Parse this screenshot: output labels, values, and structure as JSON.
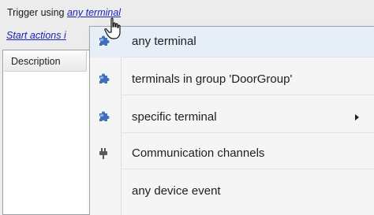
{
  "trigger": {
    "prefix": "Trigger using",
    "link": "any terminal"
  },
  "start_actions": {
    "label": "Start actions i"
  },
  "table": {
    "column_description": "Description"
  },
  "menu": {
    "items": [
      {
        "label": "any terminal",
        "icon": "puzzle-icon"
      },
      {
        "label": "terminals in group 'DoorGroup'",
        "icon": "puzzle-icon"
      },
      {
        "label": "specific terminal",
        "icon": "puzzle-icon",
        "submenu": true
      },
      {
        "label": "Communication channels",
        "icon": "plug-icon"
      },
      {
        "label": "any device event",
        "icon": ""
      }
    ]
  },
  "colors": {
    "link": "#1a23b8",
    "menu_background": "#f5f5f5",
    "icon_blue": "#3f6fb5"
  }
}
